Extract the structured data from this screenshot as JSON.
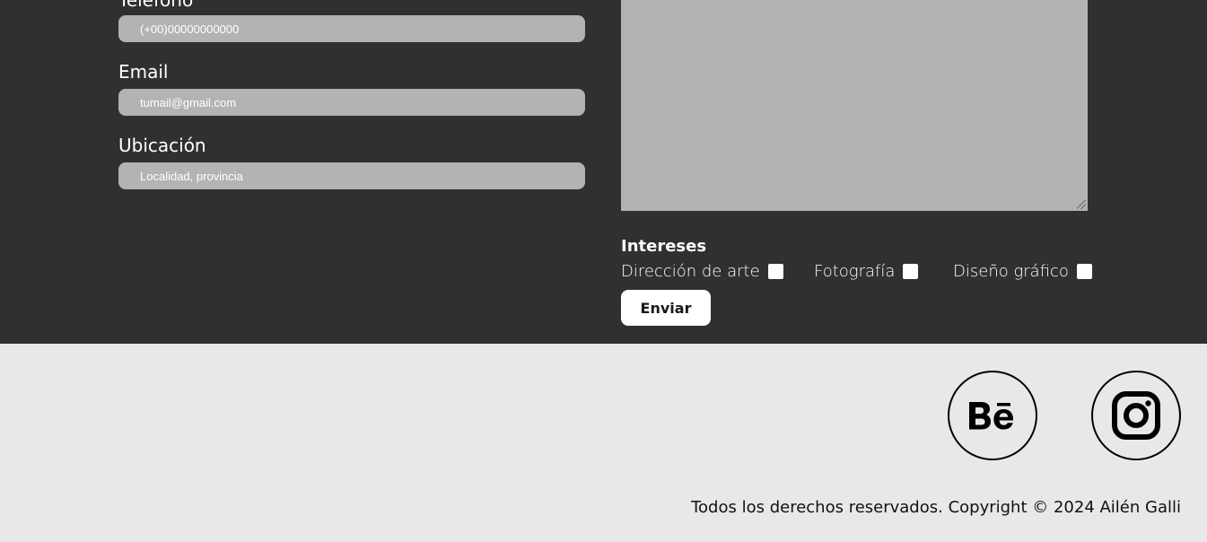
{
  "form": {
    "phone": {
      "label": "Teléfono",
      "placeholder": "(+00)00000000000"
    },
    "email": {
      "label": "Email",
      "placeholder": "tumail@gmail.com"
    },
    "location": {
      "label": "Ubicación",
      "placeholder": "Localidad, provincia"
    },
    "message": {
      "value": ""
    }
  },
  "interests": {
    "title": "Intereses",
    "options": [
      {
        "label": "Dirección de arte",
        "checked": false
      },
      {
        "label": "Fotografía",
        "checked": false
      },
      {
        "label": "Diseño gráfico",
        "checked": false
      }
    ]
  },
  "submit_label": "Enviar",
  "footer": {
    "social": [
      {
        "name": "behance",
        "icon": "behance-icon"
      },
      {
        "name": "instagram",
        "icon": "instagram-icon"
      }
    ],
    "copyright": "Todos los derechos reservados. Copyright © 2024 Ailén Galli"
  },
  "colors": {
    "contact_bg": "#303030",
    "footer_bg": "#e8e8e8",
    "input_bg": "#b3b3b3",
    "text_light": "#ffffff",
    "text_dark": "#111111"
  }
}
